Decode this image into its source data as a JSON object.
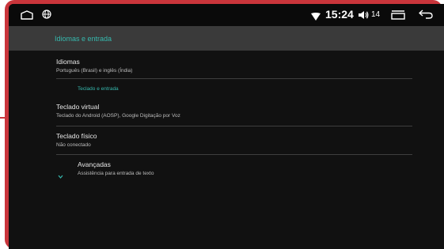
{
  "status_bar": {
    "time": "15:24",
    "volume_level": "14",
    "icons": [
      "home-outline-icon",
      "globe-icon",
      "wifi-icon",
      "volume-icon",
      "recent-apps-icon",
      "back-icon"
    ]
  },
  "app_bar": {
    "title": "Idiomas e entrada"
  },
  "items": {
    "idiomas": {
      "title": "Idiomas",
      "subtitle": "Português (Brasil) e inglês (Índia)"
    },
    "section_keyboard": "Teclado e entrada",
    "teclado_virtual": {
      "title": "Teclado virtual",
      "subtitle": "Teclado do Android (AOSP), Google Digitação por Voz"
    },
    "teclado_fisico": {
      "title": "Teclado físico",
      "subtitle": "Não conectado"
    },
    "avancadas": {
      "title": "Avançadas",
      "subtitle": "Assistência para entrada de texto"
    }
  },
  "colors": {
    "accent": "#36b8ad",
    "frame": "#c9353b",
    "background": "#111111",
    "appbar": "#3a3a3a"
  }
}
